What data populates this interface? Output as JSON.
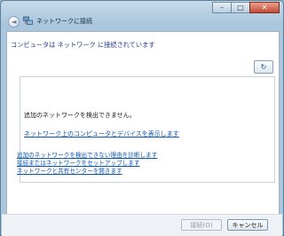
{
  "window": {
    "title": "ネットワークに接続",
    "controls": {
      "minimize": "–",
      "maximize": "□",
      "close": "✕"
    }
  },
  "main": {
    "heading": "コンピュータは ネットワーク に接続されています",
    "refresh_icon": "refresh-icon",
    "message": "追加のネットワークを検出できません。",
    "show_link": "ネットワーク上のコンピュータとデバイスを表示します"
  },
  "links": [
    "追加のネットワークを検出できない理由を診断します",
    "接続またはネットワークをセットアップします",
    "ネットワークと共有センターを開きます"
  ],
  "footer": {
    "connect_label": "接続(O)",
    "cancel_label": "キャンセル"
  }
}
